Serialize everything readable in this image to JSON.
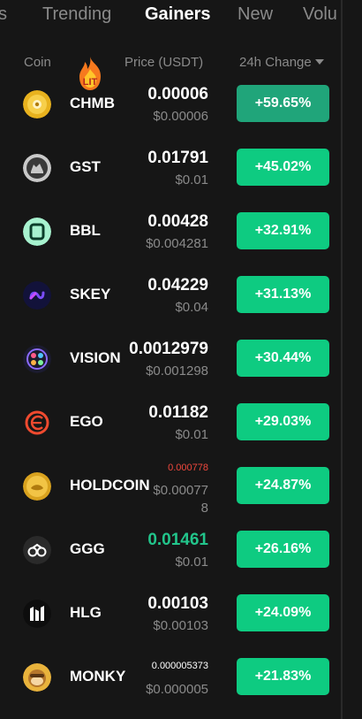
{
  "tabs": [
    {
      "label": "s"
    },
    {
      "label": "Trending"
    },
    {
      "label": "Gainers"
    },
    {
      "label": "New"
    },
    {
      "label": "Volu"
    }
  ],
  "headers": {
    "coin": "Coin",
    "price": "Price (USDT)",
    "change": "24h Change"
  },
  "badge": {
    "text": "LIT"
  },
  "rows": [
    {
      "symbol": "CHMB",
      "price": "0.00006",
      "usd": "$0.00006",
      "change": "+59.65%"
    },
    {
      "symbol": "GST",
      "price": "0.01791",
      "usd": "$0.01",
      "change": "+45.02%"
    },
    {
      "symbol": "BBL",
      "price": "0.00428",
      "usd": "$0.004281",
      "change": "+32.91%"
    },
    {
      "symbol": "SKEY",
      "price": "0.04229",
      "usd": "$0.04",
      "change": "+31.13%"
    },
    {
      "symbol": "VISION",
      "price": "0.0012979",
      "usd": "$0.001298",
      "change": "+30.44%"
    },
    {
      "symbol": "EGO",
      "price": "0.01182",
      "usd": "$0.01",
      "change": "+29.03%"
    },
    {
      "symbol": "HOLDCOIN",
      "price": "0.000778",
      "usd": "$0.00077",
      "usd_wrap": "8",
      "change": "+24.87%"
    },
    {
      "symbol": "GGG",
      "price": "0.01461",
      "usd": "$0.01",
      "change": "+26.16%"
    },
    {
      "symbol": "HLG",
      "price": "0.00103",
      "usd": "$0.00103",
      "change": "+24.09%"
    },
    {
      "symbol": "MONKY",
      "price": "0.000005373",
      "usd": "$0.000005",
      "change": "+21.83%"
    }
  ],
  "colors": {
    "accent": "#0ecb81",
    "price_down": "#f0483d",
    "price_up": "#22c58b",
    "background": "#161616"
  }
}
